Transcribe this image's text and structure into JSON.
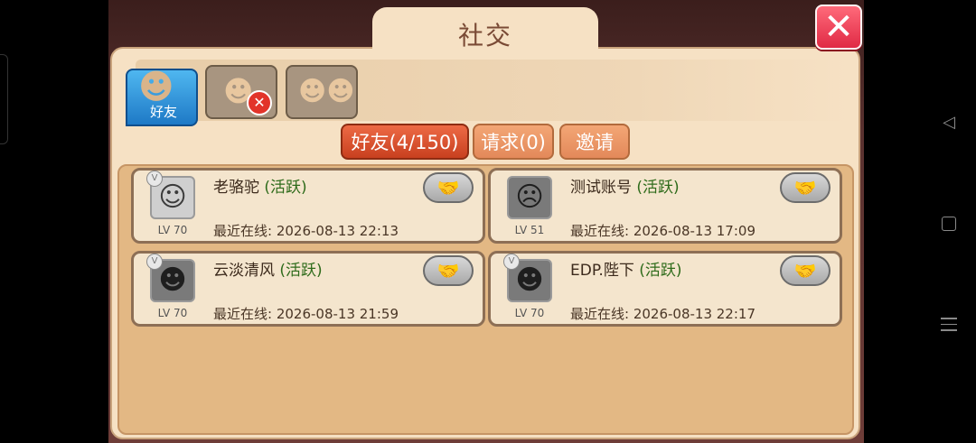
{
  "window": {
    "title": "社交",
    "close_icon": "close-icon",
    "accent_close": "#e02a45"
  },
  "categories": [
    {
      "label": "好友",
      "icon": "friends-vikings-icon",
      "active": true
    },
    {
      "label": "",
      "icon": "blocked-user-icon",
      "active": false
    },
    {
      "label": "",
      "icon": "group-icon",
      "active": false
    }
  ],
  "subtabs": [
    {
      "label": "好友(4/150)",
      "active": true
    },
    {
      "label": "请求(0)",
      "active": false
    },
    {
      "label": "邀请",
      "active": false
    }
  ],
  "friends": [
    {
      "name": "老骆驼",
      "status": "(活跃)",
      "level": "LV 70",
      "last_online": "最近在线: 2026-08-13 22:13",
      "avatar_icon": "viking-avatar-icon"
    },
    {
      "name": "测试账号",
      "status": "(活跃)",
      "level": "LV 51",
      "last_online": "最近在线: 2026-08-13 17:09",
      "avatar_icon": "knight-avatar-icon"
    },
    {
      "name": "云淡清风",
      "status": "(活跃)",
      "level": "LV 70",
      "last_online": "最近在线: 2026-08-13 21:59",
      "avatar_icon": "helmet-avatar-icon"
    },
    {
      "name": "EDP.陛下",
      "status": "(活跃)",
      "level": "LV 70",
      "last_online": "最近在线: 2026-08-13 22:17",
      "avatar_icon": "helmet-avatar-icon"
    }
  ],
  "colors": {
    "active_tab": "#1e79c6",
    "subtab_active": "#c8401f",
    "status_green": "#2e6b1a"
  }
}
